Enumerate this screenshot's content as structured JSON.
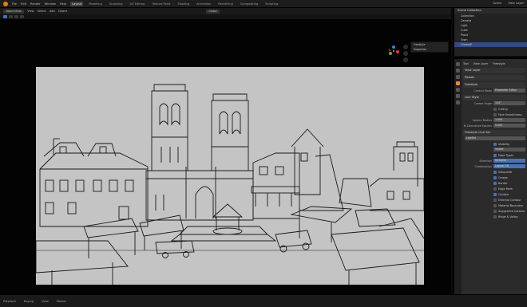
{
  "topbar": {
    "menus": [
      "File",
      "Edit",
      "Render",
      "Window",
      "Help"
    ],
    "workspaces": [
      "Layout",
      "Modeling",
      "Sculpting",
      "UV Editing",
      "Texture Paint",
      "Shading",
      "Animation",
      "Rendering",
      "Compositing",
      "Scripting"
    ],
    "active_workspace": "Layout",
    "scene": "Scene",
    "view_layer": "View Layer"
  },
  "viewport_header": {
    "mode": "Object Mode",
    "view": "View",
    "select": "Select",
    "add": "Add",
    "object": "Object",
    "orientation": "Global"
  },
  "overlay_panel": {
    "items": [
      "Freestyle",
      "Properties"
    ]
  },
  "outliner": {
    "title": "Scene Collection",
    "rows": [
      "Collection",
      "Camera",
      "Light",
      "Cube",
      "Plane",
      "Town",
      "GreaseP"
    ]
  },
  "properties": {
    "tabs": [
      "Tool",
      "View Layer",
      "Freestyle"
    ],
    "sections": {
      "view_layer": "View Layer",
      "passes": "Passes",
      "freestyle": "Freestyle",
      "control_mode": "Control Mode",
      "control_mode_value": "Parameter Editor",
      "line_style": "Line Style",
      "crease_angle_label": "Crease Angle",
      "crease_angle": "134°",
      "culling": "Culling",
      "face_smoothness": "Face Smoothness",
      "sphere_radius_label": "Sphere Radius",
      "sphere_radius": "1.000",
      "kr_epsilon_label": "Kr Derivative Epsilon",
      "kr_epsilon": "0.000",
      "freestyle_line_set": "Freestyle Line Set",
      "lineset": "LineSet",
      "visibility": "Visibility",
      "visibility_value": "Visible",
      "edge_types": "Edge Types",
      "selection": "Selection",
      "selection_value": "Inclusive",
      "combination": "Combination",
      "combination_value": "Logical OR",
      "edge_list": [
        "Silhouette",
        "Crease",
        "Border",
        "Edge Mark",
        "Contour",
        "External Contour",
        "Material Boundary",
        "Suggestive Contour",
        "Ridge & Valley"
      ]
    }
  },
  "timeline": {
    "items": [
      "Playback",
      "Keying",
      "View",
      "Marker"
    ]
  },
  "colors": {
    "accent": "#4772b3",
    "orange": "#e87d0d",
    "render_bg": "#c4c4c4"
  }
}
